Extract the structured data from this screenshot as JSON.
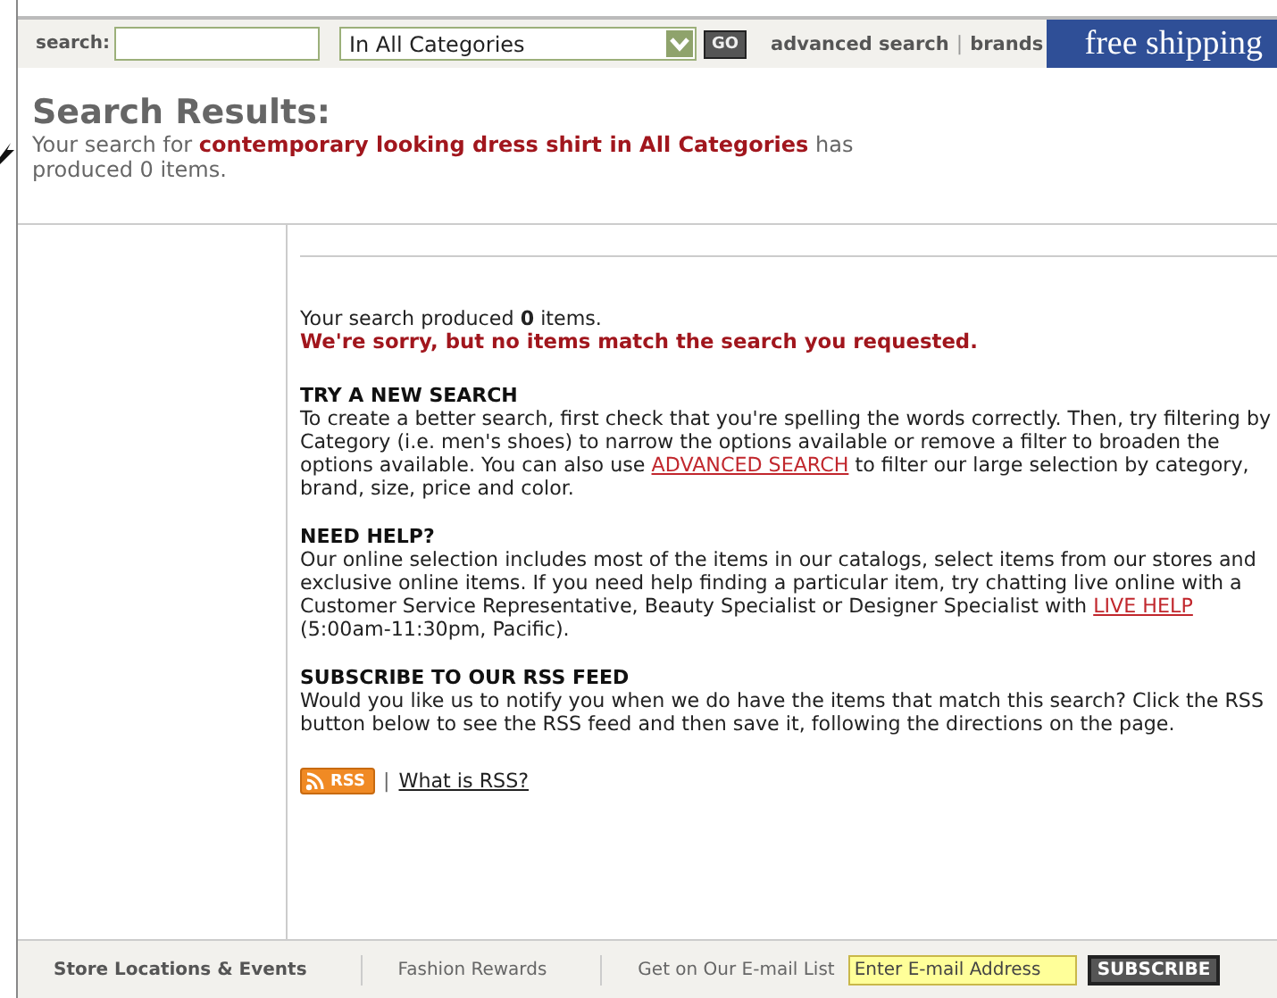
{
  "top_bar": {
    "search_label": "search:",
    "category": "In All Categories",
    "go": "GO",
    "links": [
      "advanced search",
      "brands"
    ],
    "link_separator": "|",
    "banner": "free shipping"
  },
  "results": {
    "title": "Search Results:",
    "summary": "Your search for **contemporary looking dress shirt in All Categories** has produced 0 items."
  },
  "content": {
    "count": "Your search produced **0** items.",
    "sorry": "We're sorry, but no items match the search you requested.",
    "sections": [
      {
        "heading": "TRY A NEW SEARCH",
        "before": "To create a better search, first check that you're spelling the words correctly. Then, try filtering by Category (i.e. men's shoes) to narrow the options available or remove a filter to broaden the options available. You can also use ",
        "link": "ADVANCED SEARCH",
        "after": " to filter our large selection by category, brand, size, price and color."
      },
      {
        "heading": "NEED HELP?",
        "before": "Our online selection includes most of the items in our catalogs, select items from our stores and exclusive online items. If you need help finding a particular item, try chatting live online with a Customer Service Representative, Beauty Specialist or Designer Specialist with ",
        "link": "LIVE HELP",
        "after": " (5:00am-11:30pm, Pacific)."
      },
      {
        "heading": "SUBSCRIBE TO OUR RSS FEED",
        "before": "Would you like us to notify you when we do have the items that match this search? Click the RSS button below to see the RSS feed and then save it, following the directions on the page."
      }
    ],
    "rss_button": "RSS",
    "rss_separator": "|",
    "rss_link": "What is RSS?"
  },
  "footer": {
    "links": [
      "Store Locations & Events",
      "Fashion Rewards"
    ],
    "email_label": "Get on Our E-mail List",
    "email_placeholder": "Enter E-mail Address",
    "subscribe": "SUBSCRIBE"
  }
}
